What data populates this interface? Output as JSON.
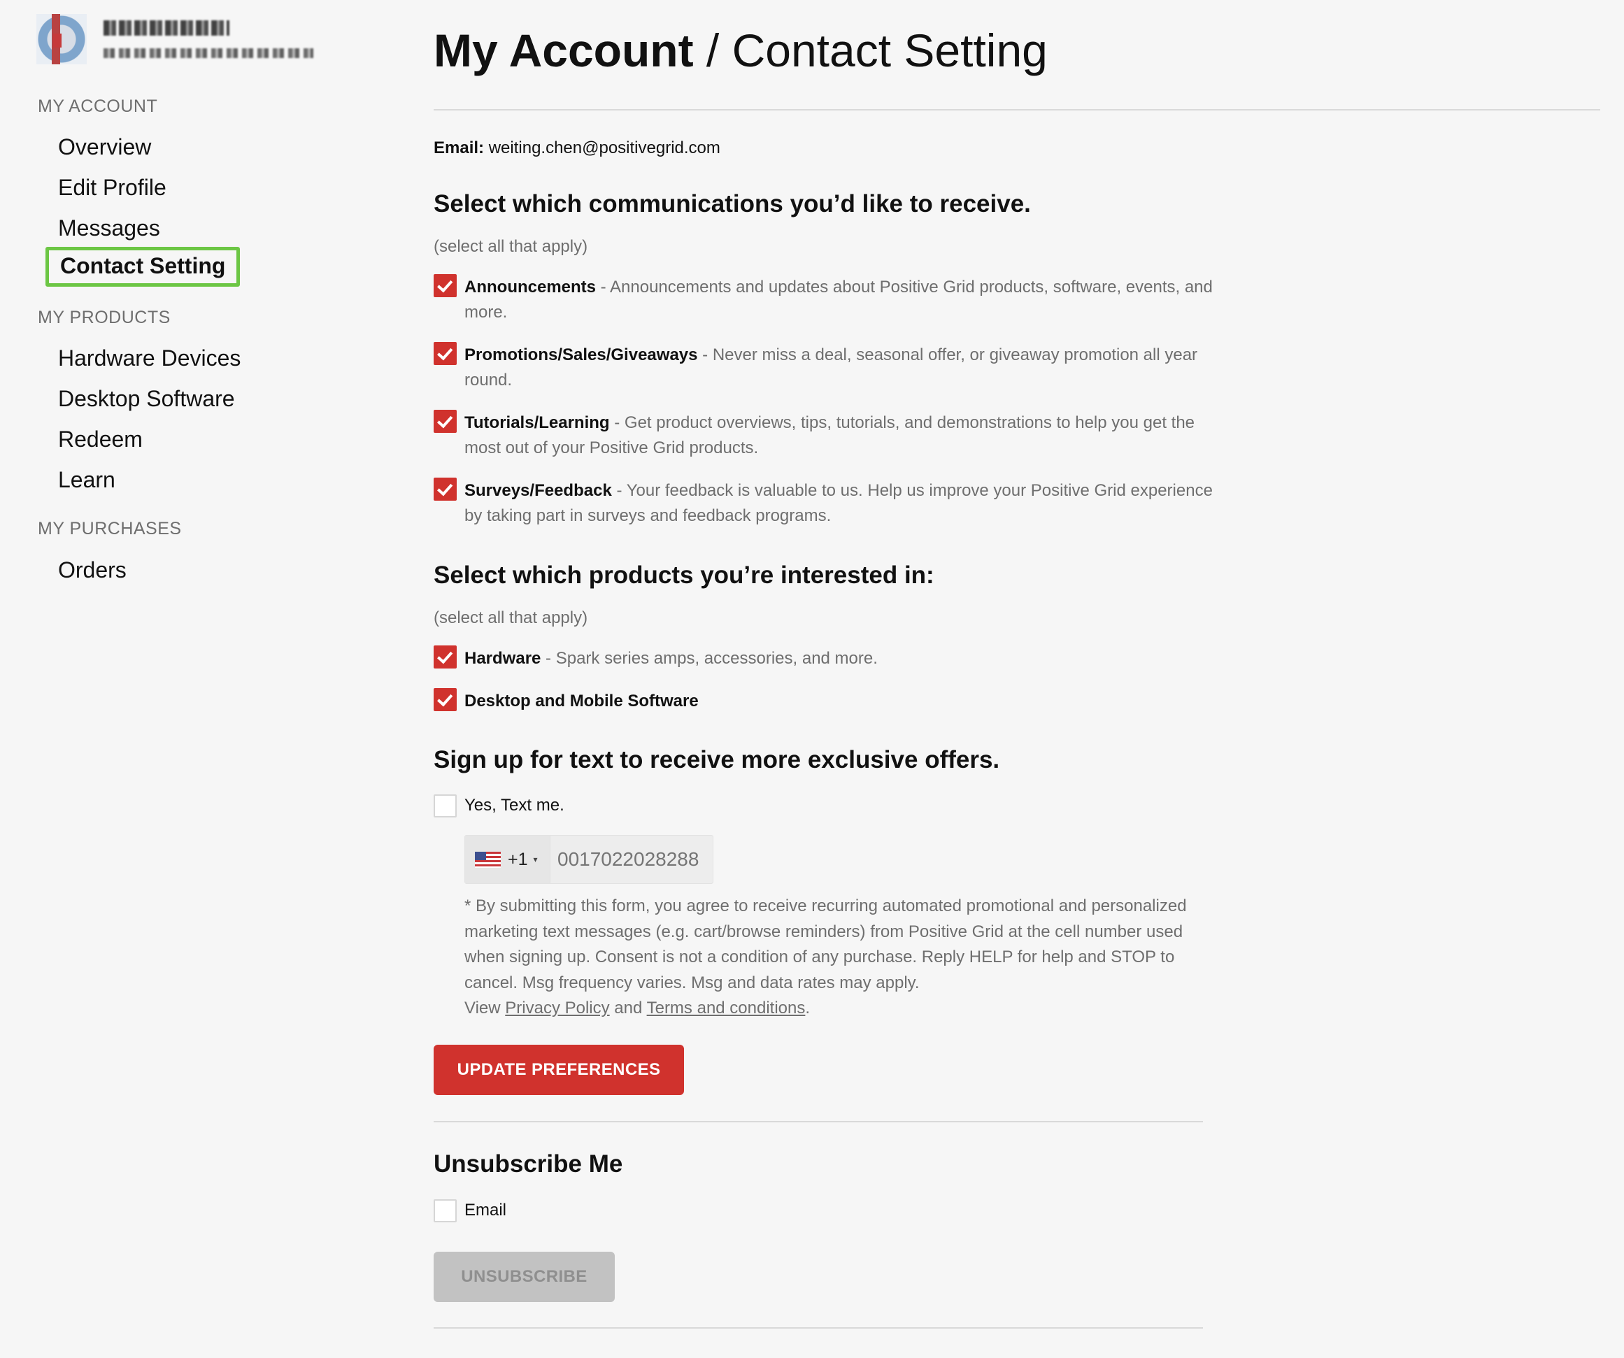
{
  "sidebar": {
    "sections": [
      {
        "heading": "MY ACCOUNT",
        "items": [
          "Overview",
          "Edit Profile",
          "Messages",
          "Contact Setting"
        ]
      },
      {
        "heading": "MY PRODUCTS",
        "items": [
          "Hardware Devices",
          "Desktop Software",
          "Redeem",
          "Learn"
        ]
      },
      {
        "heading": "MY PURCHASES",
        "items": [
          "Orders"
        ]
      }
    ],
    "active_item": "Contact Setting"
  },
  "header": {
    "title_strong": "My Account",
    "title_rest": " / Contact Setting"
  },
  "email": {
    "label": "Email:",
    "value": "weiting.chen@positivegrid.com"
  },
  "communications": {
    "title": "Select which communications you’d like to receive.",
    "hint": "(select all that apply)",
    "options": [
      {
        "label": "Announcements",
        "desc": " - Announcements and updates about Positive Grid products, software, events, and more.",
        "checked": true
      },
      {
        "label": "Promotions/Sales/Giveaways",
        "desc": " - Never miss a deal, seasonal offer, or giveaway promotion all year round.",
        "checked": true
      },
      {
        "label": "Tutorials/Learning",
        "desc": " - Get product overviews, tips, tutorials, and demonstrations to help you get the most out of your Positive Grid products.",
        "checked": true
      },
      {
        "label": "Surveys/Feedback",
        "desc": " - Your feedback is valuable to us. Help us improve your Positive Grid experience by taking part in surveys and feedback programs.",
        "checked": true
      }
    ]
  },
  "products": {
    "title": "Select which products you’re interested in:",
    "hint": "(select all that apply)",
    "options": [
      {
        "label": "Hardware",
        "desc": " - Spark series amps, accessories, and more.",
        "checked": true
      },
      {
        "label": "Desktop and Mobile Software",
        "desc": "",
        "checked": true
      }
    ]
  },
  "sms": {
    "title": "Sign up for text to receive more exclusive offers.",
    "checkbox_label": "Yes, Text me.",
    "checked": false,
    "dial_code": "+1",
    "caret": "▾",
    "phone_placeholder": "0017022028288",
    "disclaimer": "* By submitting this form, you agree to receive recurring automated promotional and personalized marketing text messages (e.g. cart/browse reminders) from Positive Grid at the cell number used when signing up. Consent is not a condition of any purchase. Reply HELP for help and STOP to cancel. Msg frequency varies. Msg and data rates may apply.",
    "view_text": "View ",
    "privacy_link": "Privacy Policy",
    "and_text": " and ",
    "terms_link": "Terms and conditions",
    "period": "."
  },
  "buttons": {
    "update": "UPDATE PREFERENCES",
    "unsubscribe": "UNSUBSCRIBE"
  },
  "unsubscribe": {
    "title": "Unsubscribe Me",
    "email_label": "Email",
    "checked": false
  },
  "colors": {
    "accent": "#d0322d",
    "active_outline": "#6cc644",
    "muted_text": "#6e6e6e",
    "background": "#f6f6f6"
  }
}
